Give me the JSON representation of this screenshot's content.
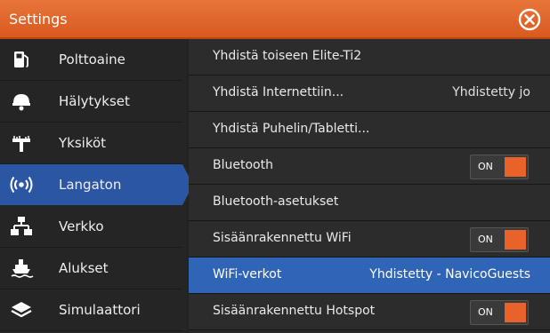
{
  "window": {
    "title": "Settings"
  },
  "colors": {
    "accent": "#e8622a",
    "selected": "#2b56a3",
    "highlight": "#2f64b6"
  },
  "sidebar": {
    "items": [
      {
        "label": "Polttoaine",
        "icon": "fuel-pump-icon"
      },
      {
        "label": "Hälytykset",
        "icon": "alarm-bell-icon"
      },
      {
        "label": "Yksiköt",
        "icon": "ruler-icon"
      },
      {
        "label": "Langaton",
        "icon": "wireless-icon",
        "selected": true
      },
      {
        "label": "Verkko",
        "icon": "network-icon"
      },
      {
        "label": "Alukset",
        "icon": "vessels-icon"
      },
      {
        "label": "Simulaattori",
        "icon": "layers-icon"
      }
    ]
  },
  "main": {
    "rows": [
      {
        "label": "Yhdistä toiseen Elite-Ti2"
      },
      {
        "label": "Yhdistä Internettiin...",
        "value": "Yhdistetty jo"
      },
      {
        "label": "Yhdistä Puhelin/Tabletti..."
      },
      {
        "label": "Bluetooth",
        "toggle": "ON"
      },
      {
        "label": "Bluetooth-asetukset"
      },
      {
        "label": "Sisäänrakennettu WiFi",
        "toggle": "ON"
      },
      {
        "label": "WiFi-verkot",
        "value": "Yhdistetty - NavicoGuests",
        "highlighted": true
      },
      {
        "label": "Sisäänrakennettu Hotspot",
        "toggle": "ON"
      }
    ]
  }
}
